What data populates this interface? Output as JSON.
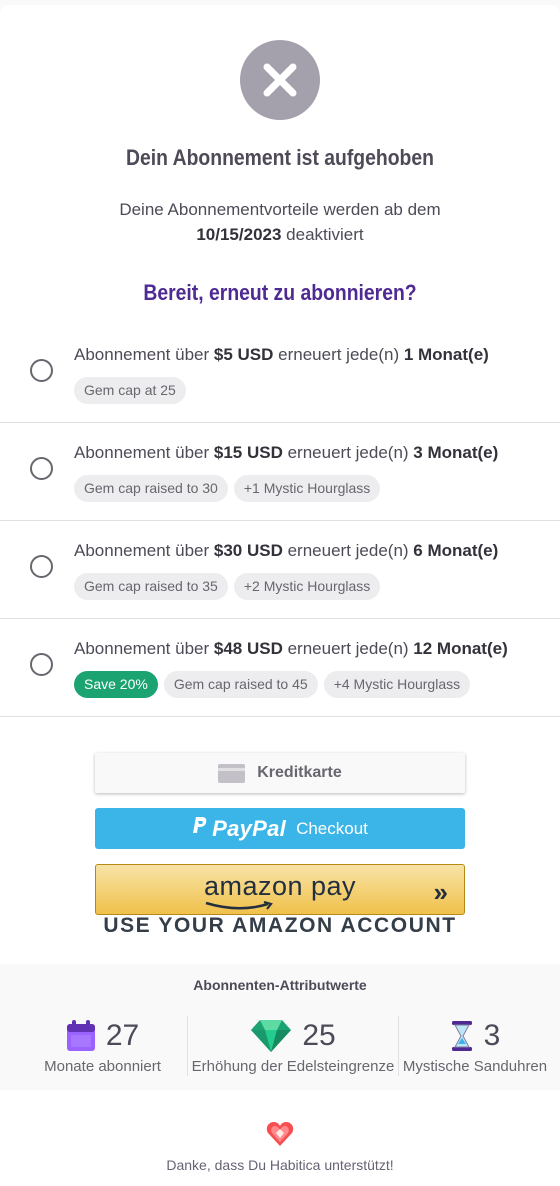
{
  "header": {
    "title": "Dein Abonnement ist aufgehoben",
    "subtitle_line1": "Deine Abonnementvorteile werden ab dem",
    "subtitle_date": "10/15/2023",
    "subtitle_suffix": " deaktiviert"
  },
  "resubscribe_heading": "Bereit, erneut zu abonnieren?",
  "plans": [
    {
      "prefix": "Abonnement über ",
      "price": "$5 USD",
      "middle": " erneuert jede(n) ",
      "period": "1 Monat(e)",
      "tags": [
        "Gem cap at 25"
      ],
      "selected": false
    },
    {
      "prefix": "Abonnement über ",
      "price": "$15 USD",
      "middle": " erneuert jede(n) ",
      "period": "3 Monat(e)",
      "tags": [
        "Gem cap raised to 30",
        "+1 Mystic Hourglass"
      ],
      "selected": false
    },
    {
      "prefix": "Abonnement über ",
      "price": "$30 USD",
      "middle": " erneuert jede(n) ",
      "period": "6 Monat(e)",
      "tags": [
        "Gem cap raised to 35",
        "+2 Mystic Hourglass"
      ],
      "selected": false
    },
    {
      "prefix": "Abonnement über ",
      "price": "$48 USD",
      "middle": " erneuert jede(n) ",
      "period": "12 Monat(e)",
      "save_tag": "Save 20%",
      "tags": [
        "Gem cap raised to 45",
        "+4 Mystic Hourglass"
      ],
      "selected": false
    }
  ],
  "payment": {
    "credit_card_label": "Kreditkarte",
    "paypal_logo": "PayPal",
    "paypal_label": "Checkout",
    "amazon_logo": "amazon pay",
    "amazon_caption": "USE YOUR AMAZON ACCOUNT"
  },
  "stats": {
    "title": "Abonnenten-Attributwerte",
    "items": [
      {
        "value": "27",
        "label": "Monate abonniert",
        "icon": "calendar-icon"
      },
      {
        "value": "25",
        "label": "Erhöhung der Edelsteingrenze",
        "icon": "gem-icon"
      },
      {
        "value": "3",
        "label": "Mystische Sanduhren",
        "icon": "hourglass-icon"
      }
    ]
  },
  "footer": {
    "thanks": "Danke, dass Du Habitica unterstützt!"
  },
  "colors": {
    "accent_purple": "#4f2a93",
    "save_green": "#1ca372",
    "paypal_blue": "#3bb5e8",
    "amazon_gold": "#f0c14b"
  }
}
